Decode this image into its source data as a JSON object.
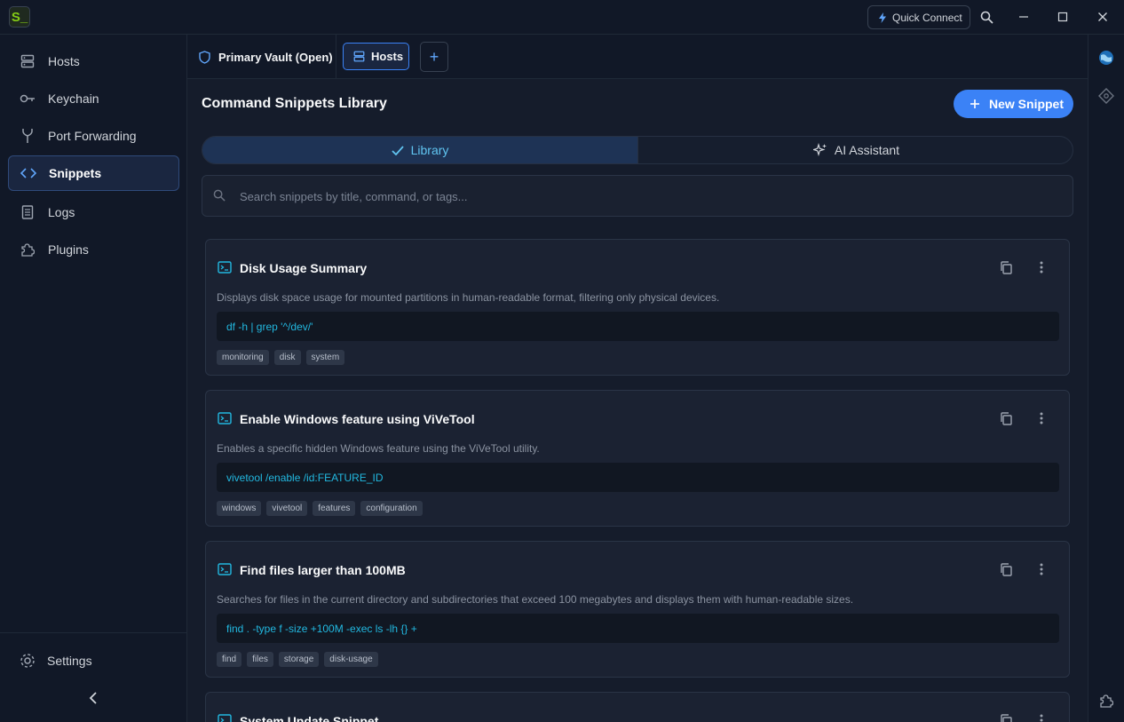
{
  "app": {
    "logo_text": "S_"
  },
  "titlebar": {
    "quick_connect_label": "Quick Connect"
  },
  "sidebar": {
    "items": [
      {
        "label": "Hosts",
        "icon": "server-icon"
      },
      {
        "label": "Keychain",
        "icon": "key-icon"
      },
      {
        "label": "Port Forwarding",
        "icon": "fork-icon"
      },
      {
        "label": "Snippets",
        "icon": "code-icon",
        "active": true
      },
      {
        "label": "Logs",
        "icon": "log-icon"
      },
      {
        "label": "Plugins",
        "icon": "puzzle-icon"
      }
    ],
    "settings_label": "Settings"
  },
  "tabs": {
    "vault_label": "Primary Vault (Open)",
    "hosts_label": "Hosts",
    "add_label": "+"
  },
  "main": {
    "title": "Command Snippets Library",
    "new_snippet_label": "New Snippet",
    "segments": {
      "library": "Library",
      "ai": "AI Assistant"
    },
    "search_placeholder": "Search snippets by title, command, or tags..."
  },
  "snippets": [
    {
      "title": "Disk Usage Summary",
      "description": "Displays disk space usage for mounted partitions in human-readable format, filtering only physical devices.",
      "command": "df -h | grep '^/dev/'",
      "tags": [
        "monitoring",
        "disk",
        "system"
      ]
    },
    {
      "title": "Enable Windows feature using ViVeTool",
      "description": "Enables a specific hidden Windows feature using the ViVeTool utility.",
      "command": "vivetool /enable /id:FEATURE_ID",
      "tags": [
        "windows",
        "vivetool",
        "features",
        "configuration"
      ]
    },
    {
      "title": "Find files larger than 100MB",
      "description": "Searches for files in the current directory and subdirectories that exceed 100 megabytes and displays them with human-readable sizes.",
      "command": "find . -type f -size +100M -exec ls -lh {} +",
      "tags": [
        "find",
        "files",
        "storage",
        "disk-usage"
      ]
    },
    {
      "title": "System Update Snippet",
      "description": "",
      "command": "",
      "tags": []
    }
  ],
  "colors": {
    "accent": "#3b82f6",
    "accent_cyan": "#22b8e0",
    "background": "#151c2b",
    "sidebar_bg": "#111827",
    "card_bg": "#1b2232"
  }
}
